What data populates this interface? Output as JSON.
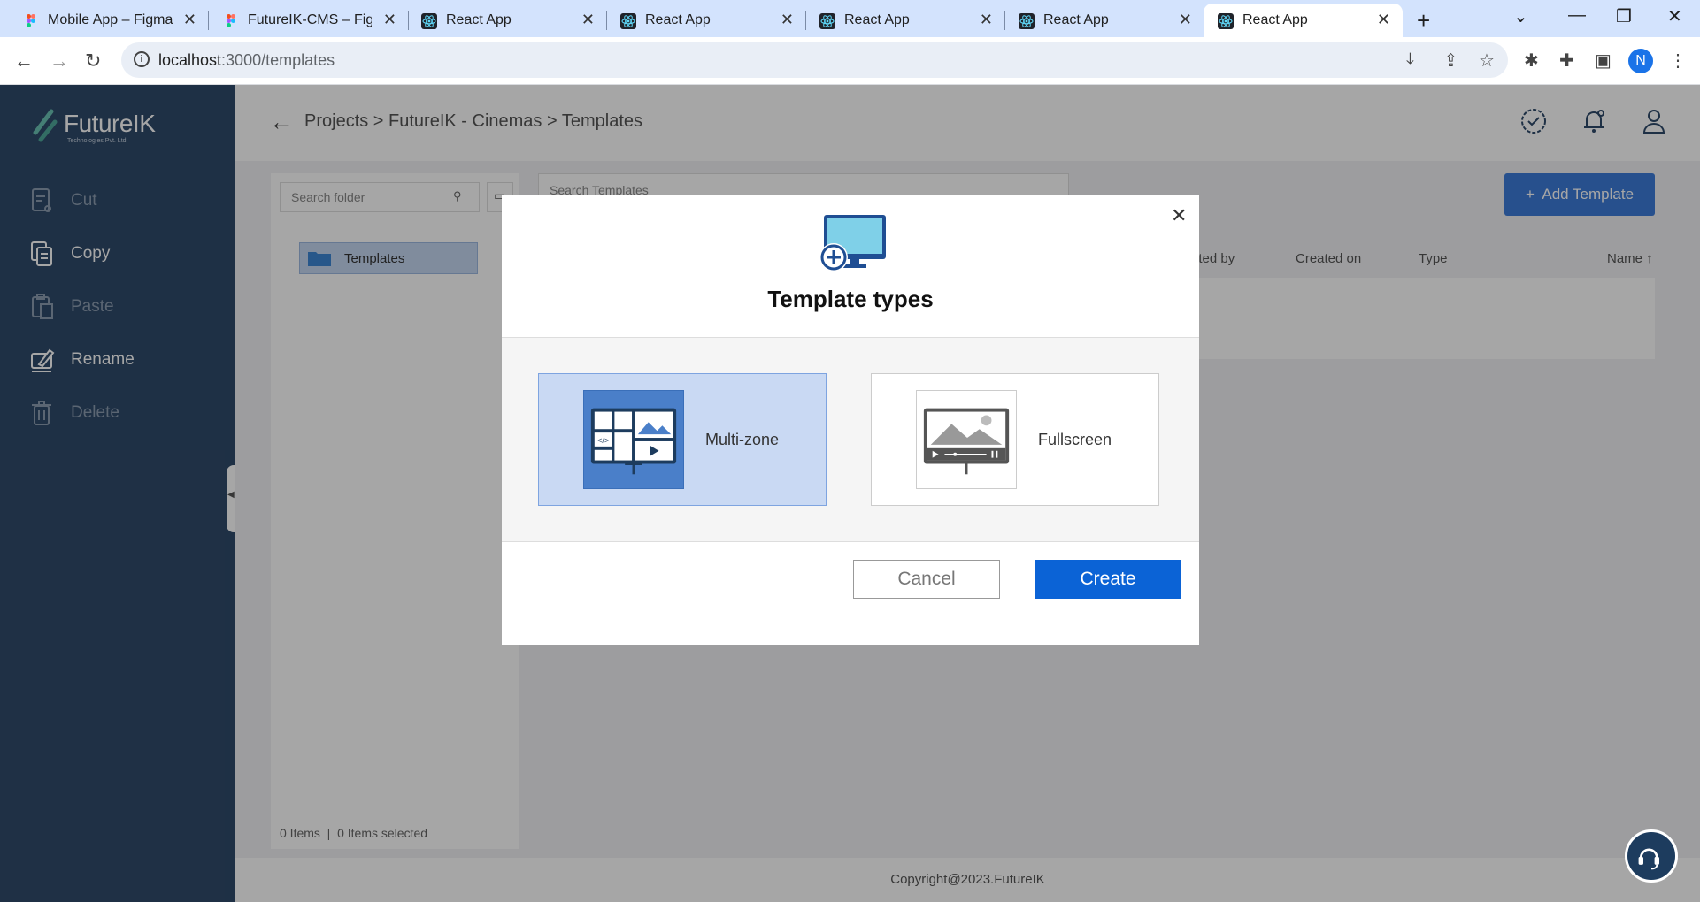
{
  "browser": {
    "tabs": [
      {
        "label": "Mobile App – Figma",
        "icon": "figma-icon"
      },
      {
        "label": "FutureIK-CMS – Figma",
        "icon": "figma-icon"
      },
      {
        "label": "React App",
        "icon": "react-icon"
      },
      {
        "label": "React App",
        "icon": "react-icon"
      },
      {
        "label": "React App",
        "icon": "react-icon"
      },
      {
        "label": "React App",
        "icon": "react-icon"
      },
      {
        "label": "React App",
        "icon": "react-icon",
        "active": true
      }
    ],
    "url_host": "localhost",
    "url_path": ":3000/templates",
    "profile_initial": "N"
  },
  "sidebar": {
    "brand": "FutureIK",
    "brand_sub": "Technologies Pvt. Ltd.",
    "items": [
      {
        "label": "Cut",
        "icon": "cut-icon",
        "enabled": false
      },
      {
        "label": "Copy",
        "icon": "copy-icon",
        "enabled": true
      },
      {
        "label": "Paste",
        "icon": "paste-icon",
        "enabled": false
      },
      {
        "label": "Rename",
        "icon": "rename-icon",
        "enabled": true
      },
      {
        "label": "Delete",
        "icon": "delete-icon",
        "enabled": false
      }
    ]
  },
  "header": {
    "breadcrumb": "Projects > FutureIK - Cinemas > Templates"
  },
  "folders": {
    "search_placeholder": "Search folder",
    "items": [
      {
        "label": "Templates"
      }
    ],
    "status": "0 Items  |  0 Items selected"
  },
  "templates": {
    "search_placeholder": "Search Templates",
    "add_label": "+  Add Template",
    "columns": [
      "ated by",
      "Created on",
      "Type",
      "Name ↑"
    ]
  },
  "footer": {
    "copyright": "Copyright@2023.FutureIK"
  },
  "modal": {
    "title": "Template types",
    "options": [
      {
        "label": "Multi-zone",
        "selected": true
      },
      {
        "label": "Fullscreen",
        "selected": false
      }
    ],
    "cancel_label": "Cancel",
    "create_label": "Create"
  },
  "colors": {
    "sidebar_bg": "#2f4a6a",
    "primary": "#0b63d6",
    "selected_option": "#c9d9f3"
  }
}
